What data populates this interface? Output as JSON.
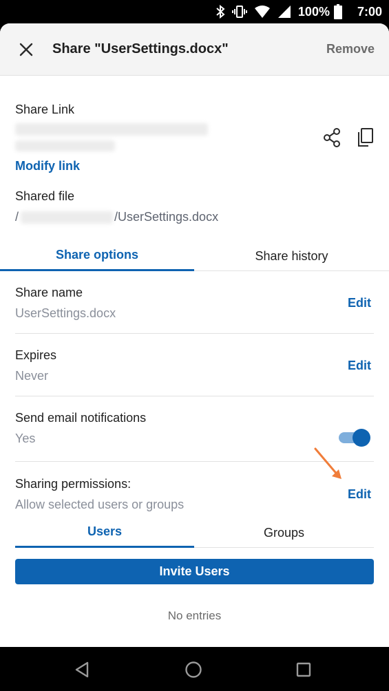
{
  "status_bar": {
    "battery": "100%",
    "time": "7:00",
    "icons": [
      "bluetooth-icon",
      "vibrate-icon",
      "wifi-icon",
      "signal-icon",
      "battery-icon"
    ]
  },
  "header": {
    "title": "Share \"UserSettings.docx\"",
    "remove_label": "Remove"
  },
  "share_link": {
    "label": "Share Link",
    "modify_label": "Modify link"
  },
  "shared_file": {
    "label": "Shared file",
    "path_prefix": "/",
    "path_suffix": "/UserSettings.docx"
  },
  "tabs": [
    {
      "label": "Share options",
      "active": true
    },
    {
      "label": "Share history",
      "active": false
    }
  ],
  "options": {
    "share_name": {
      "label": "Share name",
      "value": "UserSettings.docx",
      "action": "Edit"
    },
    "expires": {
      "label": "Expires",
      "value": "Never",
      "action": "Edit"
    },
    "email_notifications": {
      "label": "Send email notifications",
      "value": "Yes",
      "enabled": true
    },
    "permissions": {
      "label": "Sharing permissions:",
      "value": "Allow selected users or groups",
      "action": "Edit"
    }
  },
  "subtabs": [
    {
      "label": "Users",
      "active": true
    },
    {
      "label": "Groups",
      "active": false
    }
  ],
  "invite_label": "Invite Users",
  "empty_text": "No entries",
  "colors": {
    "accent": "#0e63b1",
    "annotation_arrow": "#f07d3a"
  }
}
